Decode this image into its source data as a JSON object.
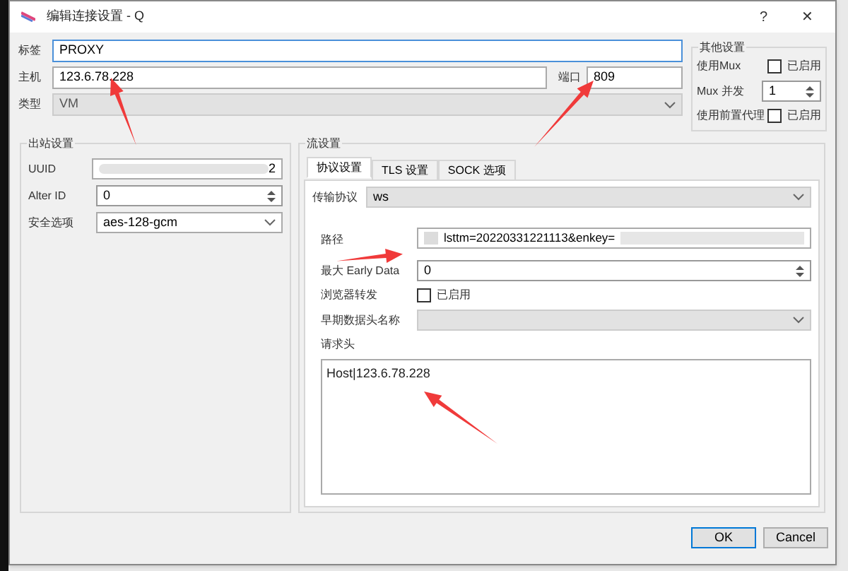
{
  "window": {
    "title": "编辑连接设置 - Q",
    "help": "?",
    "close": "✕"
  },
  "fields": {
    "tag": {
      "label": "标签",
      "value": "PROXY"
    },
    "host": {
      "label": "主机",
      "value": "123.6.78.228"
    },
    "port": {
      "label": "端口",
      "value": "809"
    },
    "type": {
      "label": "类型",
      "value": "VM"
    }
  },
  "other_settings": {
    "title": "其他设置",
    "mux": {
      "label": "使用Mux",
      "checkbox": "已启用",
      "checked": false
    },
    "mux_concurrency": {
      "label": "Mux 并发",
      "value": "1"
    },
    "front_proxy": {
      "label": "使用前置代理",
      "checkbox": "已启用",
      "checked": false
    }
  },
  "outbound": {
    "title": "出站设置",
    "rows": [
      {
        "kind": "text",
        "label": "UUID",
        "value": "2"
      },
      {
        "kind": "spin",
        "label": "Alter ID",
        "value": "0"
      },
      {
        "kind": "combo",
        "label": "安全选项",
        "value": "aes-128-gcm"
      }
    ]
  },
  "stream": {
    "title": "流设置",
    "tabs": [
      {
        "label": "协议设置",
        "selected": true
      },
      {
        "label": "TLS 设置",
        "selected": false
      },
      {
        "label": "SOCK 选项",
        "selected": false
      }
    ],
    "transport": {
      "label": "传输协议",
      "value": "ws"
    },
    "path": {
      "label": "路径",
      "value": "lsttm=20220331221113&enkey="
    },
    "early_data": {
      "label": "最大 Early Data",
      "value": "0"
    },
    "browser_forward": {
      "label": "浏览器转发",
      "checkbox": "已启用",
      "checked": false
    },
    "early_header": {
      "label": "早期数据头名称"
    },
    "headers": {
      "label": "请求头",
      "value": "Host|123.6.78.228"
    }
  },
  "buttons": [
    {
      "label": "OK",
      "default": true
    },
    {
      "label": "Cancel",
      "default": false
    }
  ]
}
